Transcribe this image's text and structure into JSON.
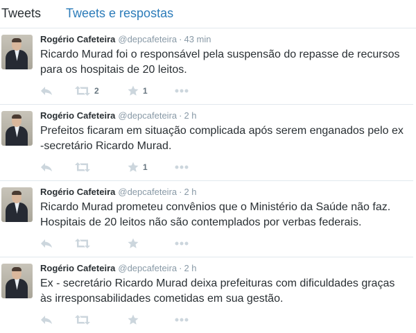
{
  "tabs": [
    {
      "label": "Tweets"
    },
    {
      "label": "Tweets e respostas"
    }
  ],
  "colors": {
    "accent": "#2b7bb9",
    "muted": "#8899a6",
    "icon": "#ccd6dd"
  },
  "icons": [
    "reply-icon",
    "retweet-icon",
    "favorite-star-icon",
    "more-ellipsis-icon"
  ],
  "tweets": [
    {
      "name": "Rogério Cafeteira",
      "handle": "@depcafeteira",
      "separator": "·",
      "time": "43 min",
      "text": "Ricardo Murad foi o responsável pela suspensão do repasse de recursos para os hospitais de 20 leitos.",
      "retweets": "2",
      "favorites": "1"
    },
    {
      "name": "Rogério Cafeteira",
      "handle": "@depcafeteira",
      "separator": "·",
      "time": "2 h",
      "text": "Prefeitos ficaram em situação complicada após serem enganados pelo ex -secretário Ricardo Murad.",
      "retweets": "",
      "favorites": "1"
    },
    {
      "name": "Rogério Cafeteira",
      "handle": "@depcafeteira",
      "separator": "·",
      "time": "2 h",
      "text": "Ricardo Murad prometeu convênios que o Ministério da Saúde não faz. Hospitais de 20 leitos não são contemplados por verbas federais.",
      "retweets": "",
      "favorites": ""
    },
    {
      "name": "Rogério Cafeteira",
      "handle": "@depcafeteira",
      "separator": "·",
      "time": "2 h",
      "text": "Ex - secretário Ricardo Murad deixa prefeituras com dificuldades graças às irresponsabilidades cometidas em sua gestão.",
      "retweets": "",
      "favorites": ""
    }
  ]
}
